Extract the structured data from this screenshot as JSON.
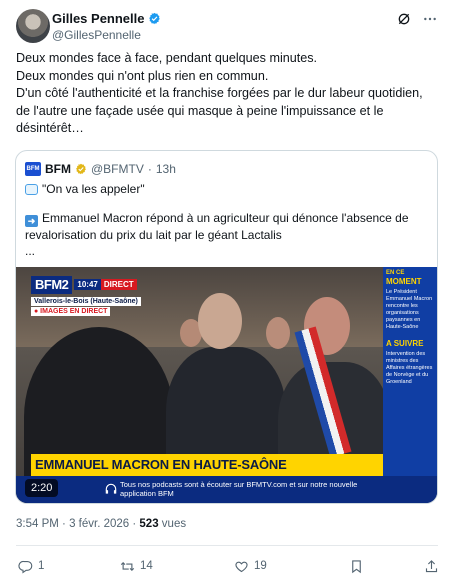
{
  "author": {
    "name": "Gilles Pennelle",
    "handle": "@GillesPennelle"
  },
  "tweet_text": "Deux mondes face à face, pendant quelques minutes.\nDeux mondes qui n'ont plus rien en commun.\nD'un côté l'authenticité et la franchise forgées par le dur labeur quotidien, de l'autre une façade usée qui masque à peine l'impuissance et le désintérêt…",
  "quoted": {
    "logo_text": "BFM",
    "name": "BFM",
    "handle": "@BFMTV",
    "age": "13h",
    "line1": "\"On va les appeler\"",
    "line2": "Emmanuel Macron répond à un agriculteur qui dénonce l'absence de revalorisation du prix du lait par le géant Lactalis",
    "ellipsis": "...",
    "video": {
      "channel": "BFM2",
      "clock": "10:47",
      "live_label": "DIRECT",
      "location": "Vallerois-le-Bois (Haute-Saône)",
      "images_live": "● IMAGES EN DIRECT",
      "side_kicker": "EN CE",
      "side_title": "MOMENT",
      "side_body": "Le Président Emmanuel Macron rencontre les organisations paysannes en Haute-Saône",
      "side_next": "A SUIVRE",
      "side_next_body": "Intervention des ministres des Affaires étrangères de Norvège et du Groenland",
      "headline": "EMMANUEL MACRON EN HAUTE-SAÔNE",
      "ticker": "Tous nos podcasts sont à écouter sur BFMTV.com et sur notre nouvelle application BFM",
      "duration": "2:20"
    }
  },
  "meta": {
    "time": "3:54 PM",
    "date": "3 févr. 2026",
    "views": "523",
    "views_label": "vues"
  },
  "actions": {
    "replies": "1",
    "retweets": "14",
    "likes": "19"
  },
  "colors": {
    "verified": "#1d9bf0",
    "secondary_text": "#536471",
    "bfm_blue": "#0b2b80",
    "bfm_yellow": "#ffd400"
  },
  "icons": [
    "verified-badge-icon",
    "grok-icon",
    "more-icon",
    "speech-bubble-icon",
    "right-arrow-icon",
    "headphones-icon",
    "reply-icon",
    "retweet-icon",
    "like-icon",
    "bookmark-icon",
    "share-icon"
  ]
}
